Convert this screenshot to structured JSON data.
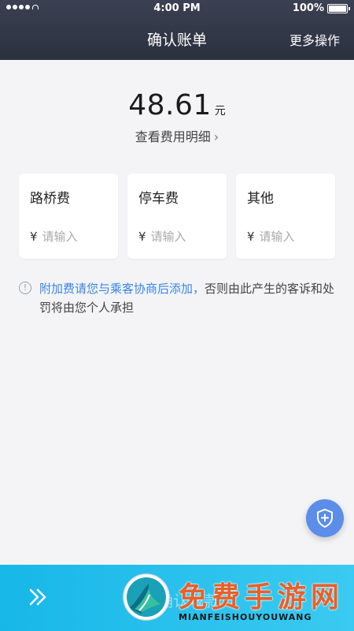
{
  "status_bar": {
    "time": "4:00 PM",
    "battery": "100%"
  },
  "header": {
    "title": "确认账单",
    "more_label": "更多操作"
  },
  "bill": {
    "amount": "48.61",
    "unit": "元",
    "detail_label": "查看费用明细"
  },
  "fees": [
    {
      "label": "路桥费",
      "currency": "¥",
      "placeholder": "请输入"
    },
    {
      "label": "停车费",
      "currency": "¥",
      "placeholder": "请输入"
    },
    {
      "label": "其他",
      "currency": "¥",
      "placeholder": "请输入"
    }
  ],
  "notice": {
    "highlight": "附加费请您与乘客协商后添加，",
    "rest": "否则由此产生的客诉和处罚将由您个人承担"
  },
  "bottom_bar": {
    "label": "确认收款"
  },
  "watermark": {
    "title": "免费手游网",
    "subtitle": "MIANFEISHOUYOUWANG"
  },
  "colors": {
    "header_bg": "#2f3444",
    "accent_blue": "#3a85e8",
    "bottom_bar": "#1fbdee",
    "float_button": "#5b8de9"
  }
}
